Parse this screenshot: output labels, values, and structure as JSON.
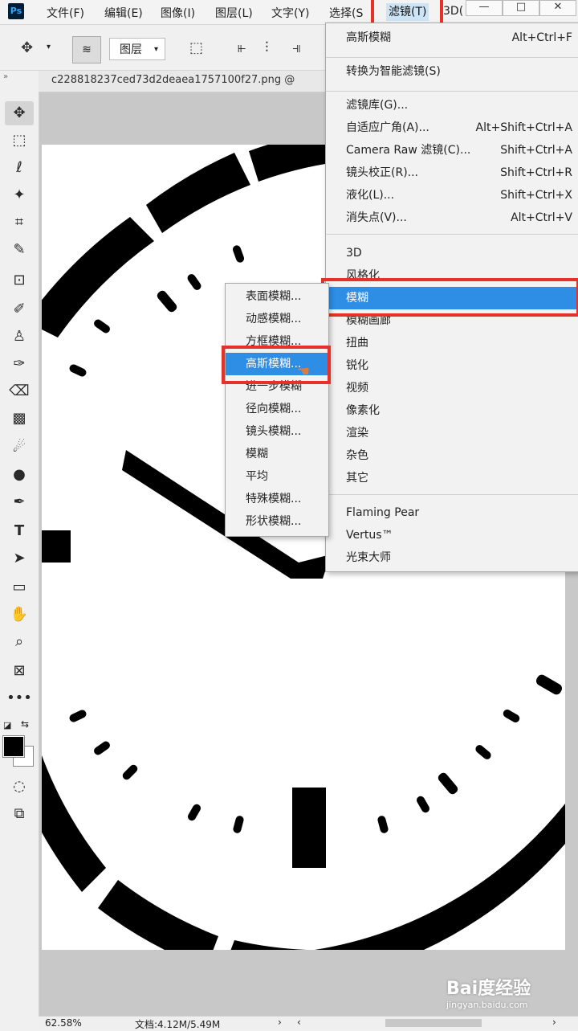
{
  "app": {
    "logo": "Ps"
  },
  "menubar": {
    "items": [
      "文件(F)",
      "编辑(E)",
      "图像(I)",
      "图层(L)",
      "文字(Y)",
      "选择(S",
      "滤镜(T)",
      "3D("
    ]
  },
  "window_controls": {
    "minimize": "—",
    "restore": "□",
    "close": "✕"
  },
  "options_bar": {
    "auto_select_target": "图层"
  },
  "document_tab": {
    "title": "c228818237ced73d2deaea1757100f27.png @"
  },
  "filter_menu": {
    "top": [
      {
        "label": "高斯模糊",
        "shortcut": "Alt+Ctrl+F"
      },
      {
        "label": "转换为智能滤镜(S)",
        "shortcut": ""
      }
    ],
    "group2": [
      {
        "label": "滤镜库(G)...",
        "shortcut": ""
      },
      {
        "label": "自适应广角(A)...",
        "shortcut": "Alt+Shift+Ctrl+A"
      },
      {
        "label": "Camera Raw 滤镜(C)...",
        "shortcut": "Shift+Ctrl+A"
      },
      {
        "label": "镜头校正(R)...",
        "shortcut": "Shift+Ctrl+R"
      },
      {
        "label": "液化(L)...",
        "shortcut": "Shift+Ctrl+X"
      },
      {
        "label": "消失点(V)...",
        "shortcut": "Alt+Ctrl+V"
      }
    ],
    "group3": [
      "3D",
      "风格化",
      "模糊",
      "模糊画廊",
      "扭曲",
      "锐化",
      "视频",
      "像素化",
      "渲染",
      "杂色",
      "其它"
    ],
    "group4": [
      "Flaming Pear",
      "Vertus™",
      "光束大师"
    ]
  },
  "blur_submenu": {
    "items": [
      "表面模糊...",
      "动感模糊...",
      "方框模糊...",
      "高斯模糊...",
      "进一步模糊",
      "径向模糊...",
      "镜头模糊...",
      "模糊",
      "平均",
      "特殊模糊...",
      "形状模糊..."
    ],
    "highlighted": "高斯模糊..."
  },
  "statusbar": {
    "zoom": "62.58%",
    "doc_info": "文档:4.12M/5.49M"
  },
  "watermark": {
    "brand": "Bai度经验",
    "url": "jingyan.baidu.com"
  },
  "colors": {
    "highlight": "#2e8ee6",
    "annotation_red": "#e53128"
  }
}
